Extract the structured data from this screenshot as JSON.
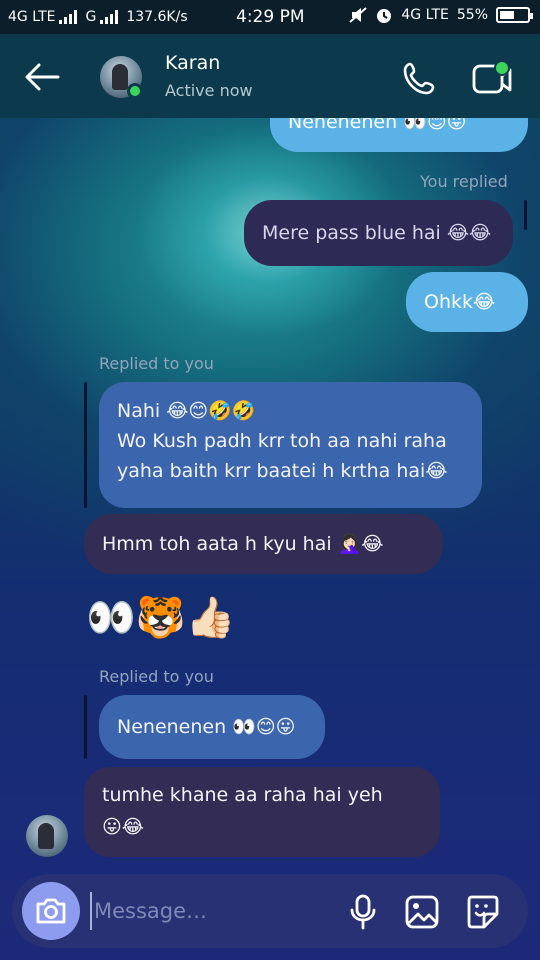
{
  "status_bar": {
    "network1": "4G LTE",
    "network2": "G",
    "speed": "137.6K/s",
    "time": "4:29 PM",
    "network3": "4G LTE",
    "battery": "55%"
  },
  "header": {
    "contact_name": "Karan",
    "contact_status": "Active now"
  },
  "messages": {
    "m0": {
      "text": "Nenenenen 👀😊😛"
    },
    "m1_label": "You replied",
    "m1": {
      "text": "Mere pass blue hai 😂😂"
    },
    "m2": {
      "text": "Ohkk😂"
    },
    "m3_label": "Replied to you",
    "m3": {
      "line1": "Nahi 😂😊🤣🤣",
      "line2": "Wo Kush padh krr toh aa nahi raha",
      "line3": "yaha baith krr baatei h krtha hai😂"
    },
    "m4": {
      "text": "Hmm toh aata h kyu hai 🤦🏻‍♀️😂"
    },
    "m5": {
      "text": "👀🐯👍🏻"
    },
    "m6_label": "Replied to you",
    "m6": {
      "text": "Nenenenen 👀😊😛"
    },
    "m7": {
      "line1": "tumhe khane aa raha hai yeh",
      "line2": "😛😂"
    }
  },
  "composer": {
    "placeholder": "Message…"
  },
  "colors": {
    "outgoing_dark": "#2d2a55",
    "outgoing_blue": "#5ab2e6",
    "incoming_dark": "#332c55",
    "incoming_blue": "#3b65ad",
    "online": "#3cd35a"
  }
}
